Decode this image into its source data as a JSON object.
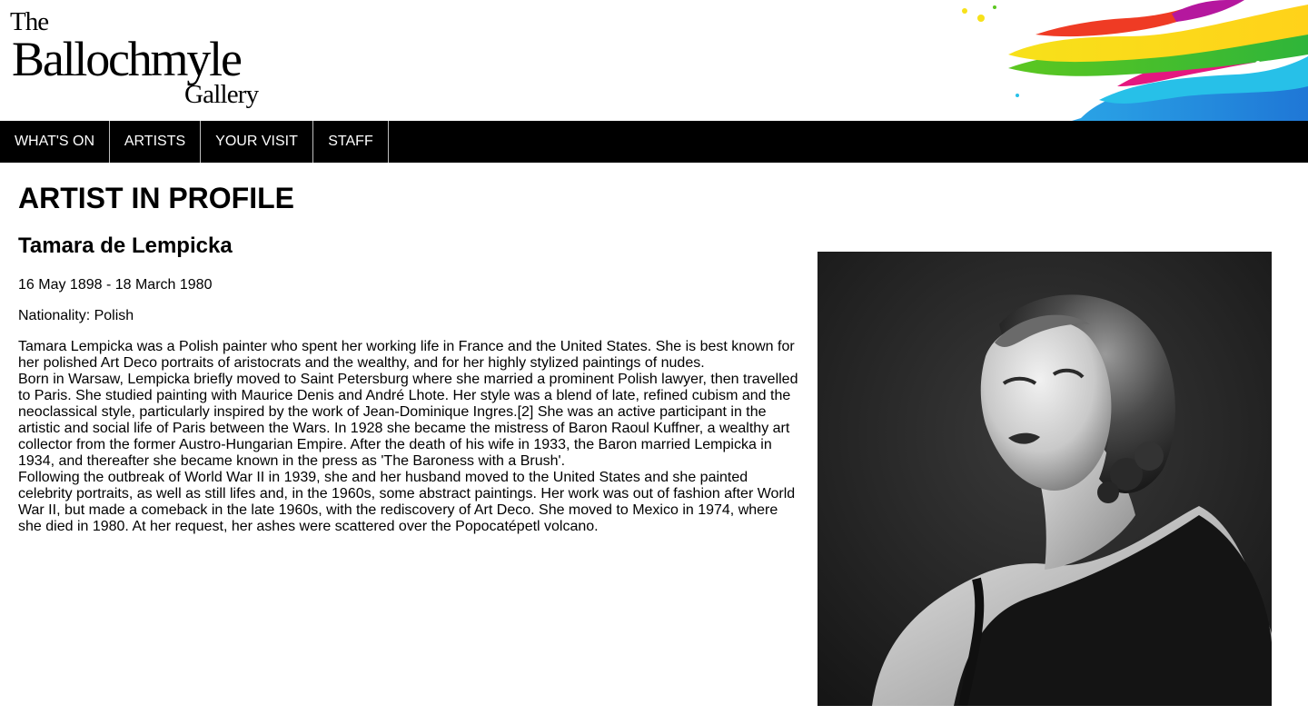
{
  "logo": {
    "line1": "The",
    "line2": "Ballochmyle",
    "line3": "Gallery"
  },
  "nav": {
    "items": [
      {
        "label": "WHAT'S ON"
      },
      {
        "label": "ARTISTS"
      },
      {
        "label": "YOUR VISIT"
      },
      {
        "label": "STAFF"
      }
    ]
  },
  "main": {
    "title": "ARTIST IN PROFILE",
    "artist_name": "Tamara de Lempicka",
    "dates": "16 May 1898 - 18 March 1980",
    "nationality": "Nationality: Polish",
    "bio": [
      "Tamara Lempicka was a Polish painter who spent her working life in France and the United States. She is best known for her polished Art Deco portraits of aristocrats and the wealthy, and for her highly stylized paintings of nudes.",
      "Born in Warsaw, Lempicka briefly moved to Saint Petersburg where she married a prominent Polish lawyer, then travelled to Paris. She studied painting with Maurice Denis and André Lhote. Her style was a blend of late, refined cubism and the neoclassical style, particularly inspired by the work of Jean-Dominique Ingres.[2] She was an active participant in the artistic and social life of Paris between the Wars. In 1928 she became the mistress of Baron Raoul Kuffner, a wealthy art collector from the former Austro-Hungarian Empire. After the death of his wife in 1933, the Baron married Lempicka in 1934, and thereafter she became known in the press as 'The Baroness with a Brush'.",
      "Following the outbreak of World War II in 1939, she and her husband moved to the United States and she painted celebrity portraits, as well as still lifes and, in the 1960s, some abstract paintings. Her work was out of fashion after World War II, but made a comeback in the late 1960s, with the rediscovery of Art Deco. She moved to Mexico in 1974, where she died in 1980. At her request, her ashes were scattered over the Popocatépetl volcano."
    ]
  },
  "colors": {
    "nav_background": "#000000",
    "nav_text": "#ffffff",
    "nav_divider": "#bdbdbd",
    "page_background": "#ffffff"
  },
  "images": {
    "header_decoration": "paint-splash-image",
    "portrait": "black-and-white-portrait-photo"
  }
}
